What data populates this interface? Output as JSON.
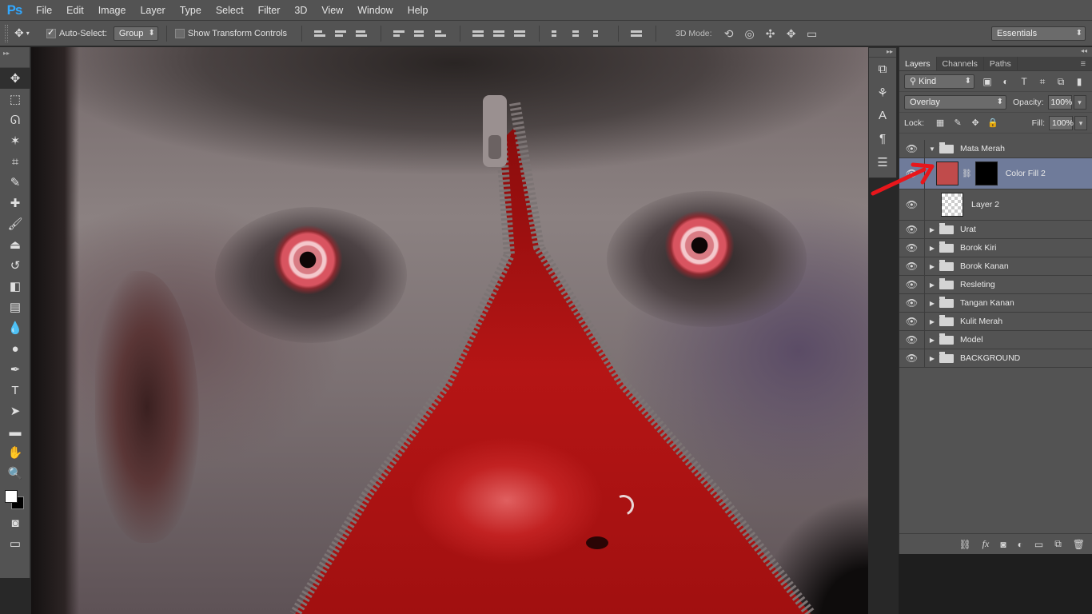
{
  "app": {
    "logo": "Ps"
  },
  "menu": [
    "File",
    "Edit",
    "Image",
    "Layer",
    "Type",
    "Select",
    "Filter",
    "3D",
    "View",
    "Window",
    "Help"
  ],
  "options": {
    "auto_select_label": "Auto-Select:",
    "auto_select_checked": true,
    "auto_select_value": "Group",
    "show_transform_label": "Show Transform Controls",
    "mode_3d_label": "3D Mode:",
    "workspace": "Essentials"
  },
  "tools": [
    "move-tool",
    "marquee-tool",
    "lasso-tool",
    "magic-wand-tool",
    "crop-tool",
    "eyedropper-tool",
    "healing-brush-tool",
    "brush-tool",
    "clone-stamp-tool",
    "history-brush-tool",
    "eraser-tool",
    "gradient-tool",
    "blur-tool",
    "dodge-tool",
    "pen-tool",
    "type-tool",
    "path-selection-tool",
    "rectangle-tool",
    "hand-tool",
    "zoom-tool"
  ],
  "swatches": {
    "foreground": "#ffffff",
    "background": "#000000"
  },
  "layers_panel": {
    "tabs": [
      "Layers",
      "Channels",
      "Paths"
    ],
    "active_tab": "Layers",
    "filter_kind": "Kind",
    "blend_mode": "Overlay",
    "opacity_label": "Opacity:",
    "opacity": "100%",
    "lock_label": "Lock:",
    "fill_label": "Fill:",
    "fill": "100%",
    "layers": [
      {
        "name": "Mata Merah",
        "type": "group",
        "expanded": true
      },
      {
        "name": "Color Fill 2",
        "type": "fill",
        "selected": true,
        "fill_color": "#c04b4b"
      },
      {
        "name": "Layer 2",
        "type": "pixel"
      },
      {
        "name": "Urat",
        "type": "group"
      },
      {
        "name": "Borok Kiri",
        "type": "group"
      },
      {
        "name": "Borok Kanan",
        "type": "group"
      },
      {
        "name": "Resleting",
        "type": "group"
      },
      {
        "name": "Tangan Kanan",
        "type": "group"
      },
      {
        "name": "Kulit Merah",
        "type": "group"
      },
      {
        "name": "Model",
        "type": "group"
      },
      {
        "name": "BACKGROUND",
        "type": "group"
      }
    ]
  },
  "colors": {
    "ui_bg": "#535353",
    "selected_layer": "#6f7b9a",
    "annotation_arrow": "#e8161b"
  }
}
